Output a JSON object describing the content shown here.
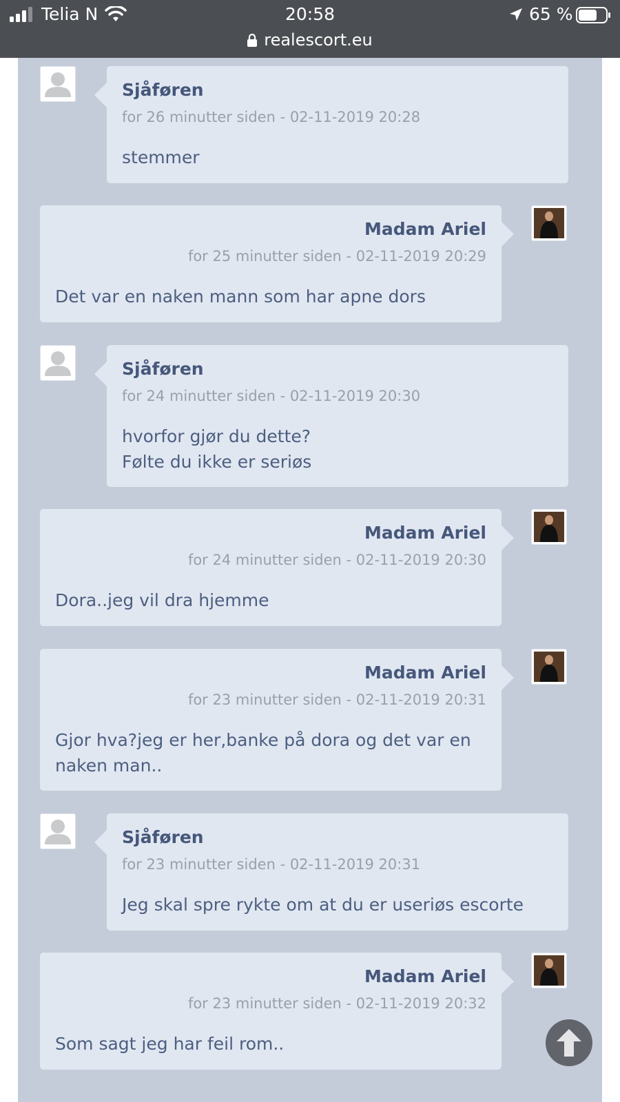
{
  "status_bar": {
    "carrier": "Telia N",
    "time": "20:58",
    "battery": "65 %",
    "url": "realescort.eu"
  },
  "messages": [
    {
      "sender": "Sjåføren",
      "time": "for 26 minutter siden - 02-11-2019 20:28",
      "text": "stemmer"
    },
    {
      "sender": "Madam Ariel",
      "time": "for 25 minutter siden - 02-11-2019 20:29",
      "text": "Det var en naken mann som har apne dors"
    },
    {
      "sender": "Sjåføren",
      "time": "for 24 minutter siden - 02-11-2019 20:30",
      "text": "hvorfor gjør du dette?\nFølte du ikke er seriøs"
    },
    {
      "sender": "Madam Ariel",
      "time": "for 24 minutter siden - 02-11-2019 20:30",
      "text": "Dora..jeg vil dra hjemme"
    },
    {
      "sender": "Madam Ariel",
      "time": "for 23 minutter siden - 02-11-2019 20:31",
      "text": "Gjor hva?jeg er her,banke på dora og det var en\nnaken man.."
    },
    {
      "sender": "Sjåføren",
      "time": "for 23 minutter siden - 02-11-2019 20:31",
      "text": "Jeg skal spre rykte om at du er useriøs escorte"
    },
    {
      "sender": "Madam Ariel",
      "time": "for 23 minutter siden - 02-11-2019 20:32",
      "text": "Som sagt jeg har feil rom.."
    }
  ],
  "icons": {
    "signal": "signal-icon",
    "wifi": "wifi-icon",
    "location": "location-arrow-icon",
    "battery": "battery-icon",
    "lock": "lock-icon",
    "scroll_top": "arrow-up-icon"
  },
  "colors": {
    "status_bar": "#4b4e52",
    "page_background": "#c4ccd9",
    "bubble": "#e0e7f1",
    "sender_name": "#46577a",
    "timestamp": "#9aa0a8",
    "message_text": "#4d5e80"
  }
}
